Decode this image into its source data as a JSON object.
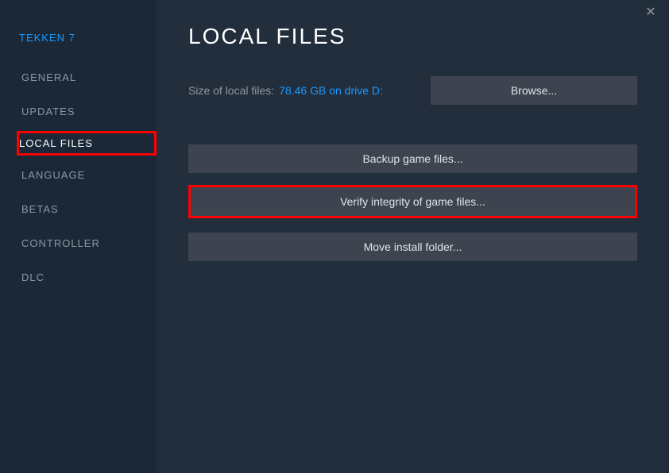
{
  "sidebar": {
    "game_title": "TEKKEN 7",
    "items": [
      {
        "label": "GENERAL"
      },
      {
        "label": "UPDATES"
      },
      {
        "label": "LOCAL FILES",
        "active": true
      },
      {
        "label": "LANGUAGE"
      },
      {
        "label": "BETAS"
      },
      {
        "label": "CONTROLLER"
      },
      {
        "label": "DLC"
      }
    ]
  },
  "main": {
    "title": "LOCAL FILES",
    "size_label": "Size of local files:",
    "size_value": "78.46 GB on drive D:",
    "browse_label": "Browse...",
    "backup_label": "Backup game files...",
    "verify_label": "Verify integrity of game files...",
    "move_label": "Move install folder..."
  },
  "close_glyph": "✕"
}
